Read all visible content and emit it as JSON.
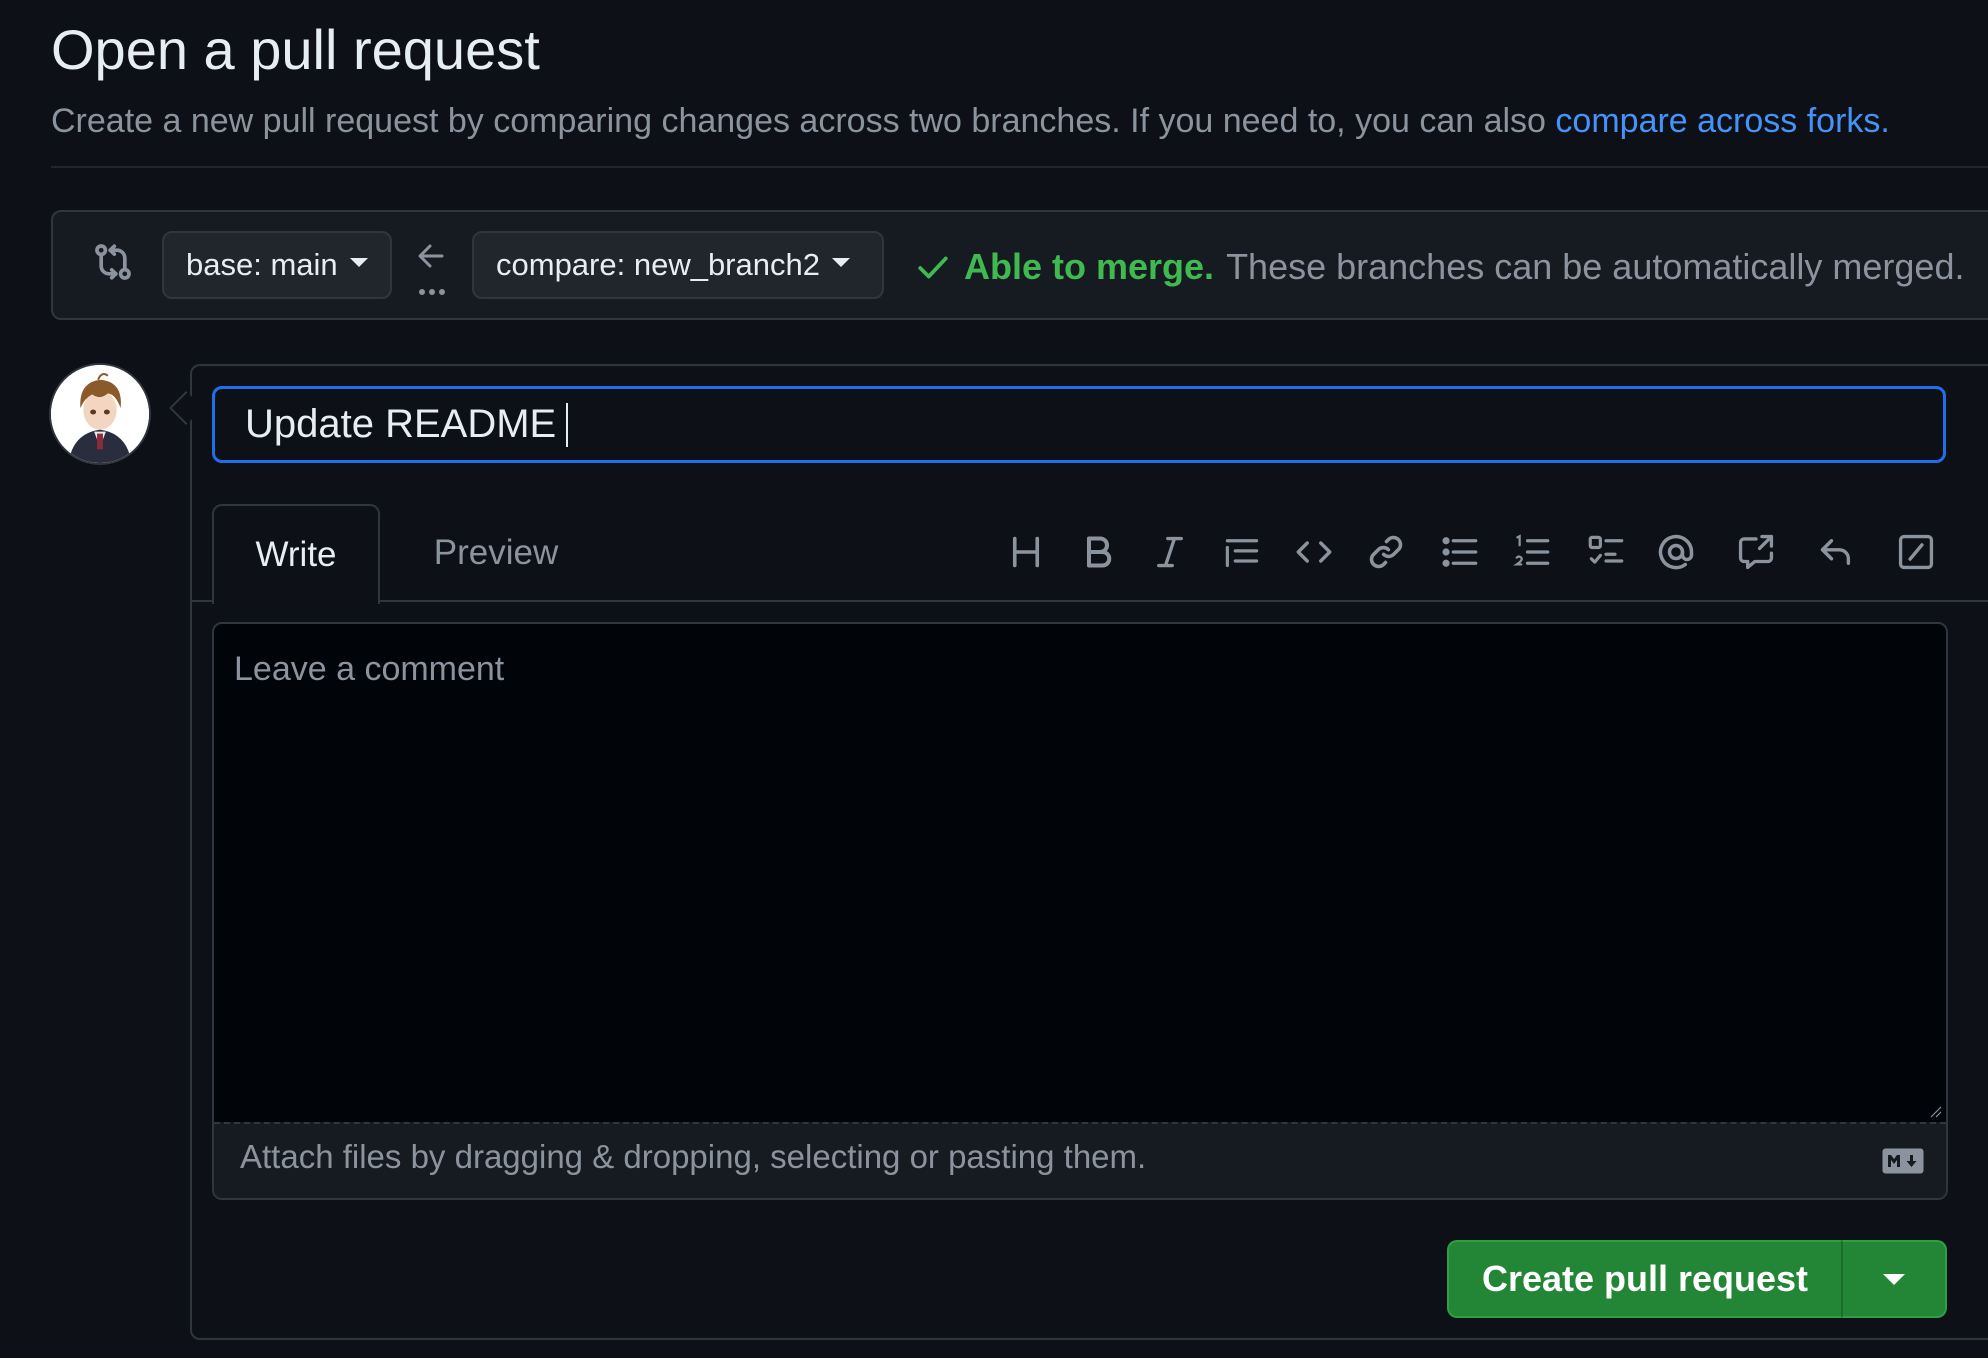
{
  "page": {
    "title": "Open a pull request",
    "subtitle_text": "Create a new pull request by comparing changes across two branches. If you need to, you can also ",
    "subtitle_link": "compare across forks."
  },
  "compare_bar": {
    "base_label": "base: main",
    "compare_label": "compare: new_branch2",
    "merge_status": "Able to merge.",
    "merge_message": "These branches can be automatically merged."
  },
  "composer": {
    "title_value": "Update README",
    "tabs": [
      "Write",
      "Preview"
    ],
    "toolbar": [
      "heading-icon",
      "bold-icon",
      "italic-icon",
      "quote-icon",
      "code-icon",
      "link-icon",
      "bulleted-list-icon",
      "numbered-list-icon",
      "task-list-icon",
      "mention-icon",
      "cross-reference-icon",
      "saved-replies-icon",
      "slash-commands-icon"
    ],
    "comment_placeholder": "Leave a comment",
    "attach_text": "Attach files by dragging & dropping, selecting or pasting them.",
    "submit_label": "Create pull request"
  },
  "colors": {
    "background": "#0d1117",
    "accent": "#1f6feb",
    "link": "#4493f8",
    "success": "#3fb950",
    "button": "#238636"
  }
}
